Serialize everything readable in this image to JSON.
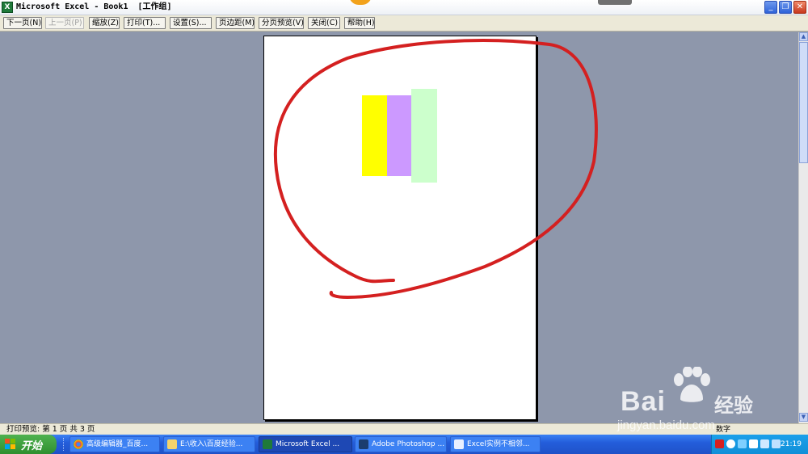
{
  "window": {
    "title": "Microsoft Excel - Book1  [工作组]",
    "app_icon": "excel-icon",
    "controls": {
      "minimize": "_",
      "restore": "❐",
      "close": "✕"
    }
  },
  "toolbar": {
    "next_page": "下一页(N)",
    "prev_page": "上一页(P)",
    "zoom": "缩放(Z)",
    "print": "打印(T)...",
    "setup": "设置(S)...",
    "margins": "页边距(M)",
    "page_break_preview": "分页预览(V)",
    "close": "关闭(C)",
    "help": "帮助(H)"
  },
  "page": {
    "bars": [
      {
        "name": "yellow-bar",
        "color": "#ffff00"
      },
      {
        "name": "purple-bar",
        "color": "#cc99ff"
      },
      {
        "name": "green-bar",
        "color": "#ccffcc"
      }
    ],
    "annotation_color": "#d42020"
  },
  "status": {
    "text": "打印预览: 第 1 页  共 3 页",
    "mode": "数字"
  },
  "taskbar": {
    "start_label": "开始",
    "tasks": [
      {
        "label": "高级编辑器_百度...",
        "icon": "chrome-icon"
      },
      {
        "label": "E:\\收入\\百度经验...",
        "icon": "folder-icon"
      },
      {
        "label": "Microsoft Excel ...",
        "icon": "excel-icon"
      },
      {
        "label": "Adobe Photoshop ...",
        "icon": "photoshop-icon"
      },
      {
        "label": "Excel实例不相邻...",
        "icon": "document-icon"
      }
    ],
    "clock": "21:19"
  },
  "watermark": {
    "brand": "Bai",
    "brand_cn": "经验",
    "url": "jingyan.baidu.com"
  }
}
